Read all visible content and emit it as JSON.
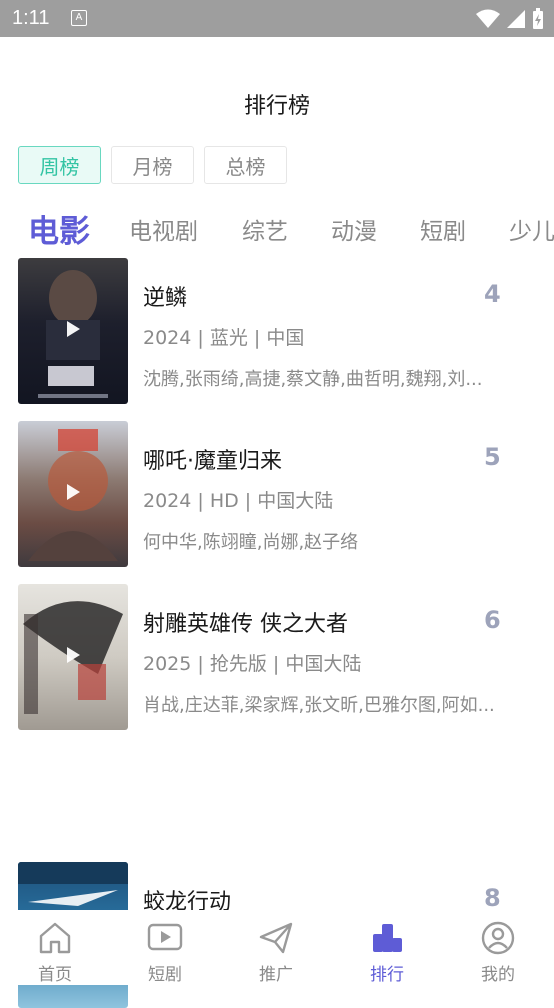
{
  "status_bar": {
    "time": "1:11",
    "notification_letter": "A"
  },
  "page": {
    "title": "排行榜"
  },
  "period_tabs": [
    {
      "label": "周榜",
      "active": true
    },
    {
      "label": "月榜",
      "active": false
    },
    {
      "label": "总榜",
      "active": false
    }
  ],
  "category_tabs": [
    {
      "label": "电影",
      "active": true
    },
    {
      "label": "电视剧",
      "active": false
    },
    {
      "label": "综艺",
      "active": false
    },
    {
      "label": "动漫",
      "active": false
    },
    {
      "label": "短剧",
      "active": false
    },
    {
      "label": "少儿",
      "active": false
    }
  ],
  "items": [
    {
      "title": "逆鳞",
      "meta": "2024 | 蓝光 | 中国",
      "cast": "沈腾,张雨绮,高捷,蔡文静,曲哲明,魏翔,刘...",
      "rank": "4"
    },
    {
      "title": "哪吒·魔童归来",
      "meta": "2024 | HD | 中国大陆",
      "cast": "何中华,陈翊瞳,尚娜,赵子络",
      "rank": "5"
    },
    {
      "title": "射雕英雄传 侠之大者",
      "meta": "2025 | 抢先版 | 中国大陆",
      "cast": "肖战,庄达菲,梁家辉,张文昕,巴雅尔图,阿如...",
      "rank": "6"
    },
    {
      "title": "蛟龙行动",
      "meta": "",
      "cast": "",
      "rank": "8"
    }
  ],
  "bottom_nav": [
    {
      "label": "首页",
      "icon": "home-icon",
      "active": false
    },
    {
      "label": "短剧",
      "icon": "play-icon",
      "active": false
    },
    {
      "label": "推广",
      "icon": "send-icon",
      "active": false
    },
    {
      "label": "排行",
      "icon": "rank-icon",
      "active": true
    },
    {
      "label": "我的",
      "icon": "user-icon",
      "active": false
    }
  ],
  "colors": {
    "accent": "#5e5cd6",
    "period_active": "#33c4a4",
    "rank": "#9da3ba",
    "status_bar": "#9e9e9e"
  }
}
